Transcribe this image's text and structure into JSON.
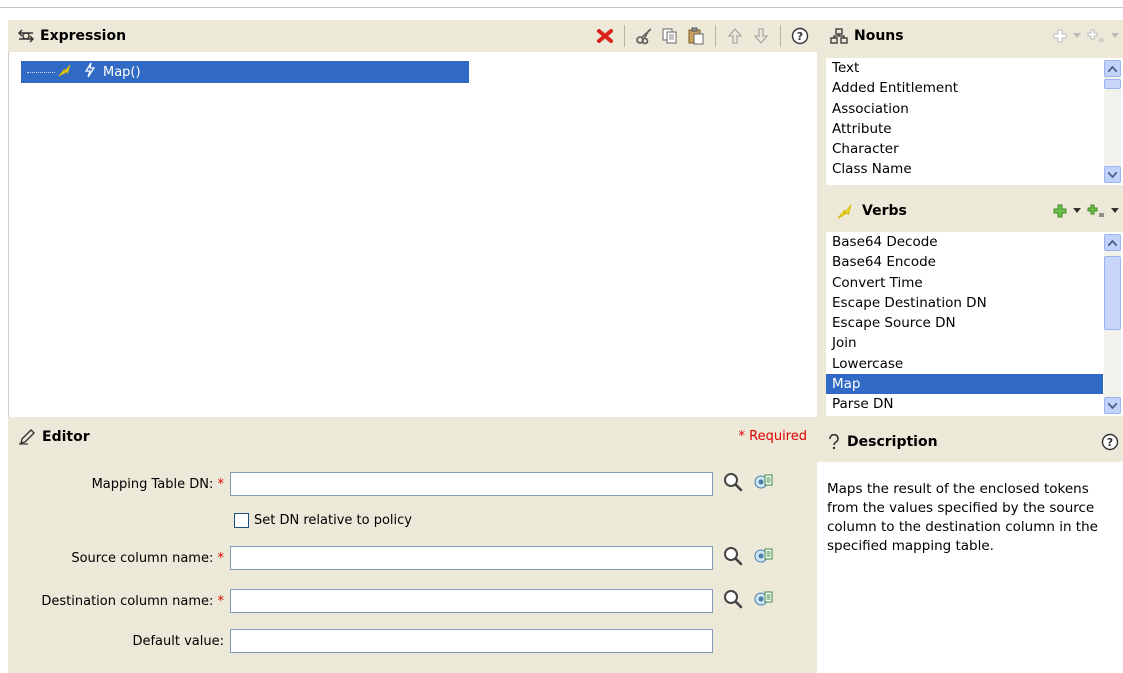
{
  "expression": {
    "title": "Expression",
    "tree_item": "Map()"
  },
  "editor": {
    "title": "Editor",
    "required_note": "* Required",
    "fields": [
      {
        "label": "Mapping Table DN:",
        "required": "*",
        "value": ""
      },
      {
        "label": "Source column name:",
        "required": "*",
        "value": ""
      },
      {
        "label": "Destination column name:",
        "required": "*",
        "value": ""
      },
      {
        "label": "Default value:",
        "required": "",
        "value": ""
      }
    ],
    "checkbox_label": "Set DN relative to policy"
  },
  "nouns": {
    "title": "Nouns",
    "items": [
      "Text",
      "Added Entitlement",
      "Association",
      "Attribute",
      "Character",
      "Class Name"
    ]
  },
  "verbs": {
    "title": "Verbs",
    "items": [
      "Base64 Decode",
      "Base64 Encode",
      "Convert Time",
      "Escape Destination DN",
      "Escape Source DN",
      "Join",
      "Lowercase",
      "Map",
      "Parse DN"
    ],
    "selected": "Map"
  },
  "description": {
    "title": "Description",
    "text": "Maps the result of the enclosed tokens from the values specified by the source column to the destination column in the specified mapping table."
  },
  "icons": {
    "toolbar": [
      "delete-icon",
      "cut-icon",
      "copy-icon",
      "paste-icon",
      "move-up-icon",
      "move-down-icon",
      "help-icon"
    ],
    "field_actions": [
      "browse-icon",
      "object-selector-icon"
    ]
  },
  "colors": {
    "panel_bg": "#ece9d8",
    "selection": "#316ac5",
    "required": "#e00000"
  }
}
